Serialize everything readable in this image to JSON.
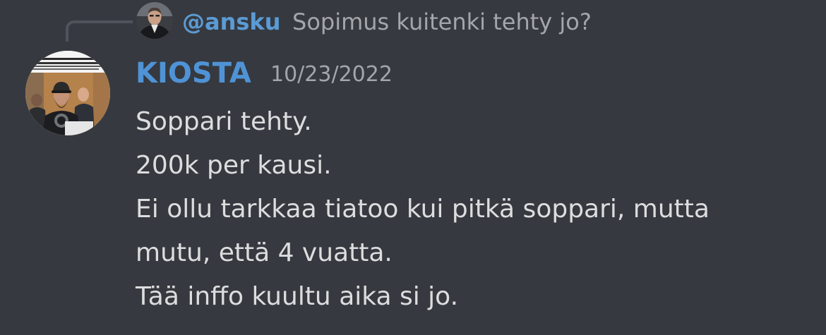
{
  "reply": {
    "author": "@ansku",
    "text": "Sopimus kuitenki tehty jo?"
  },
  "message": {
    "author": "KIOSTA",
    "timestamp": "10/23/2022",
    "lines": [
      "Soppari tehty.",
      "200k per kausi.",
      "Ei ollu tarkkaa tiatoo kui pitkä soppari, mutta",
      "mutu, että 4 vuatta.",
      "Tää inffo kuultu aika si jo."
    ]
  },
  "colors": {
    "background": "#36393f",
    "author": "#4f93d6",
    "text": "#dcddde",
    "muted": "#a3a6aa",
    "spine": "#4f545c"
  },
  "icons": {
    "reply_avatar": "reply-user-avatar-photo",
    "avatar": "user-avatar-photo"
  }
}
